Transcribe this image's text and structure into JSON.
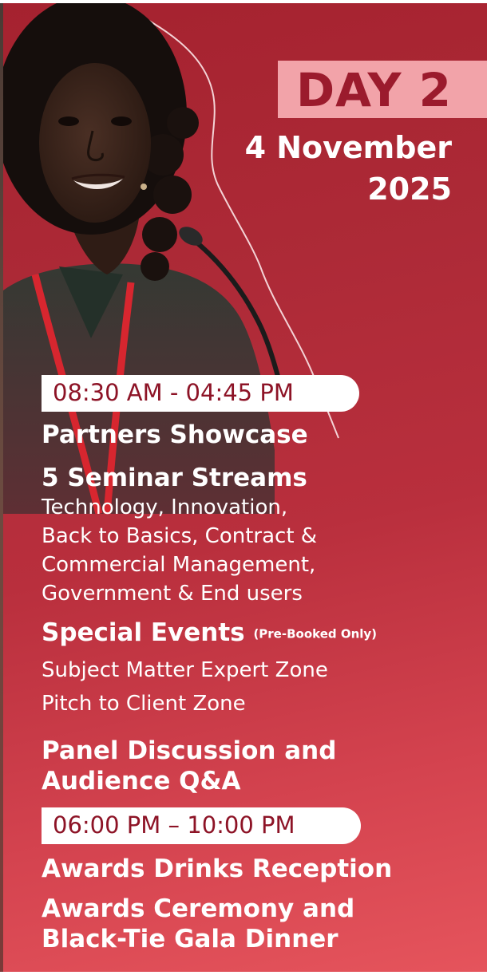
{
  "badge": {
    "day": "DAY 2",
    "date_line1": "4 November",
    "date_line2": "2025"
  },
  "colors": {
    "background_top": "#a5222f",
    "background_bottom": "#e5545c",
    "badge_bg": "#f2a3a9",
    "badge_text": "#9b1b2d",
    "pill_text": "#8d1326"
  },
  "session1": {
    "time": "08:30 AM - 04:45 PM",
    "partners": "Partners Showcase",
    "seminar_title": "5 Seminar Streams",
    "seminar_lines": [
      "Technology, Innovation,",
      "Back to Basics, Contract &",
      "Commercial Management,",
      "Government & End users"
    ],
    "special_title": "Special Events",
    "special_note": "(Pre-Booked Only)",
    "special_items": [
      "Subject Matter Expert Zone",
      "Pitch to Client Zone"
    ],
    "panel_lines": [
      "Panel Discussion and",
      "Audience Q&A"
    ]
  },
  "session2": {
    "time": "06:00 PM – 10:00 PM",
    "drinks": "Awards Drinks Reception",
    "gala_lines": [
      "Awards Ceremony and",
      "Black-Tie Gala Dinner"
    ]
  }
}
